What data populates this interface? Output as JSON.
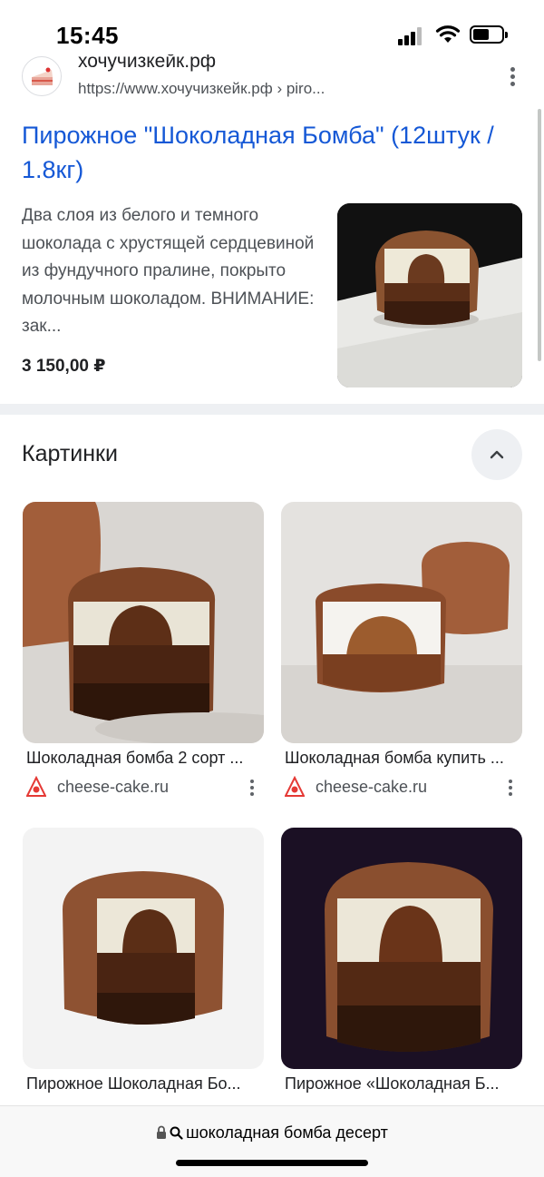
{
  "status_bar": {
    "time": "15:45"
  },
  "result": {
    "site_name": "хочучизкейк.рф",
    "url": "https://www.хочучизкейк.рф › piro...",
    "title": "Пирожное \"Шоколадная Бомба\" (12штук / 1.8кг)",
    "snippet": "Два слоя из белого и темного шоколада с хрустящей сердцевиной из фундучного пралине, покрыто молочным шоколадом. ВНИМАНИЕ: зак...",
    "price": "3 150,00 ₽"
  },
  "images_section": {
    "title": "Картинки",
    "items": [
      {
        "caption": "Шоколадная бомба 2 сорт ...",
        "source": "cheese-cake.ru"
      },
      {
        "caption": "Шоколадная бомба купить ...",
        "source": "cheese-cake.ru"
      },
      {
        "caption": "Пирожное Шоколадная Бо...",
        "source": ""
      },
      {
        "caption": "Пирожное «Шоколадная Б...",
        "source": ""
      }
    ]
  },
  "bottom_bar": {
    "url_text": "шоколадная бомба десерт"
  },
  "colors": {
    "link": "#1558d6",
    "text": "#202124",
    "secondary_text": "#4d5156",
    "chip_bg": "#eef0f3"
  }
}
